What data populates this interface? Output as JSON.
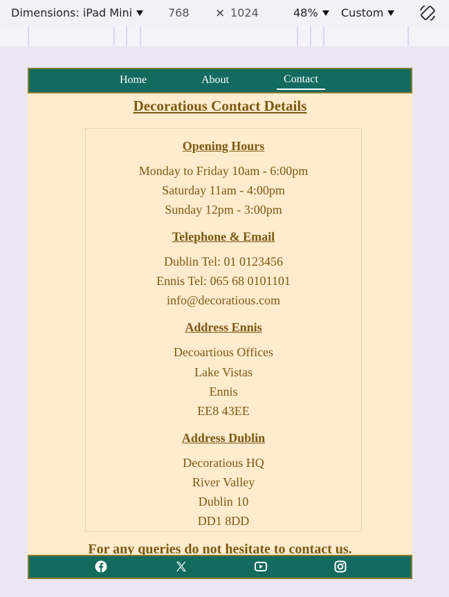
{
  "devtools": {
    "dimensions_label": "Dimensions: iPad Mini",
    "width_value": "768",
    "times_symbol": "×",
    "height_value": "1024",
    "zoom_label": "48%",
    "throttle_label": "Custom"
  },
  "nav": {
    "items": [
      {
        "label": "Home"
      },
      {
        "label": "About"
      },
      {
        "label": "Contact"
      }
    ]
  },
  "page": {
    "title": "Decoratious Contact Details",
    "opening_hours": {
      "heading": "Opening Hours",
      "lines": [
        "Monday to Friday 10am - 6:00pm",
        "Saturday 11am - 4:00pm",
        "Sunday 12pm - 3:00pm"
      ]
    },
    "telephone_email": {
      "heading": "Telephone & Email",
      "lines": [
        "Dublin Tel: 01 0123456",
        "Ennis Tel: 065 68 0101101",
        "info@decoratious.com"
      ]
    },
    "address_ennis": {
      "heading": "Address Ennis",
      "lines": [
        "Decoartious Offices",
        "Lake Vistas",
        "Ennis",
        "EE8 43EE"
      ]
    },
    "address_dublin": {
      "heading": "Address Dublin",
      "lines": [
        "Decoratious HQ",
        "River Valley",
        "Dublin 10",
        "DD1 8DD"
      ]
    },
    "footer_text": "For any queries do not hesitate to contact us."
  },
  "footer": {
    "icons": [
      "facebook-icon",
      "x-icon",
      "youtube-icon",
      "instagram-icon"
    ]
  },
  "colors": {
    "nav_bg": "#136a5e",
    "page_bg": "#ffebcd",
    "text": "#7a5a12",
    "border": "#8a7a2a"
  }
}
